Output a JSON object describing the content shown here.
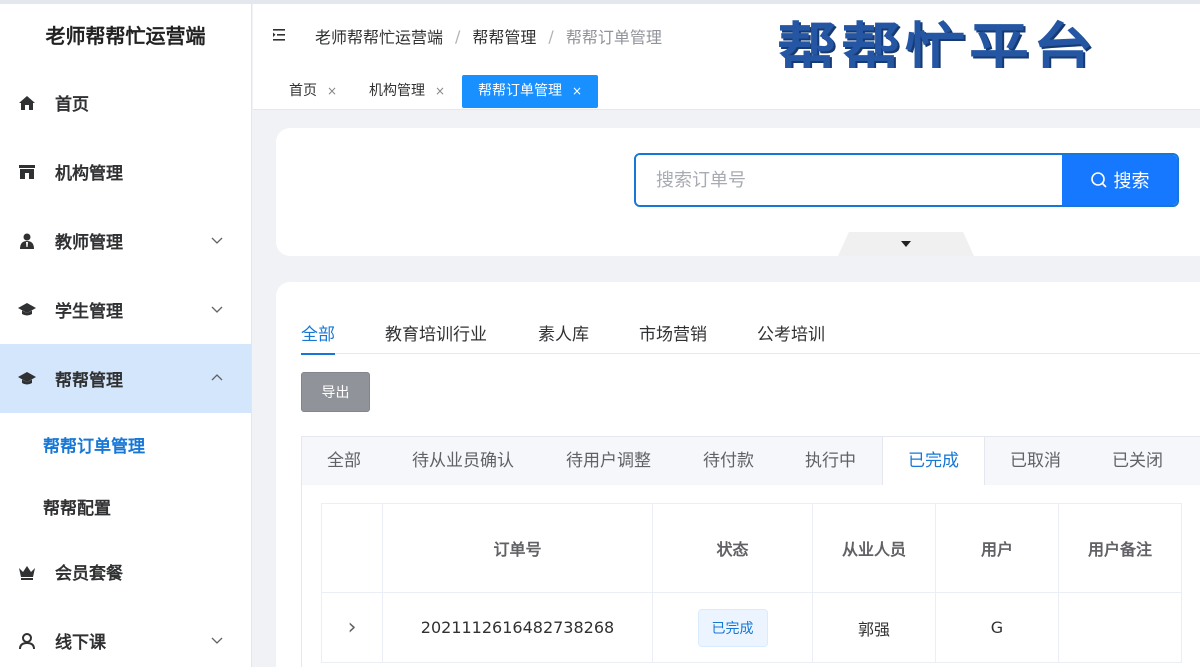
{
  "sidebar": {
    "logo": "老师帮帮忙运营端",
    "items": [
      {
        "label": "首页"
      },
      {
        "label": "机构管理"
      },
      {
        "label": "教师管理"
      },
      {
        "label": "学生管理"
      },
      {
        "label": "帮帮管理"
      },
      {
        "label": "会员套餐"
      },
      {
        "label": "线下课"
      }
    ],
    "sub_items": [
      {
        "label": "帮帮订单管理"
      },
      {
        "label": "帮帮配置"
      }
    ]
  },
  "header": {
    "breadcrumb": [
      "老师帮帮忙运营端",
      "帮帮管理",
      "帮帮订单管理"
    ],
    "separator": "/",
    "banner": "帮帮忙平台"
  },
  "tags": [
    {
      "label": "首页",
      "close": "×"
    },
    {
      "label": "机构管理",
      "close": "×"
    },
    {
      "label": "帮帮订单管理",
      "close": "×"
    }
  ],
  "search": {
    "placeholder": "搜索订单号",
    "value": "",
    "button_label": "搜索"
  },
  "category_tabs": [
    "全部",
    "教育培训行业",
    "素人库",
    "市场营销",
    "公考培训"
  ],
  "export_label": "导出",
  "status_tabs": [
    "全部",
    "待从业员确认",
    "待用户调整",
    "待付款",
    "执行中",
    "已完成",
    "已取消",
    "已关闭"
  ],
  "table": {
    "columns": [
      "",
      "订单号",
      "状态",
      "从业人员",
      "用户",
      "用户备注"
    ],
    "rows": [
      {
        "expand": "›",
        "order_no": "2021112616482738268",
        "status": "已完成",
        "worker": "郭强",
        "user": "G",
        "remark": ""
      }
    ]
  },
  "colors": {
    "accent": "#1677d6",
    "primary_button": "#1677ff",
    "banner_text": "#2456a3",
    "sidebar_active_bg": "#d4e6fb"
  }
}
